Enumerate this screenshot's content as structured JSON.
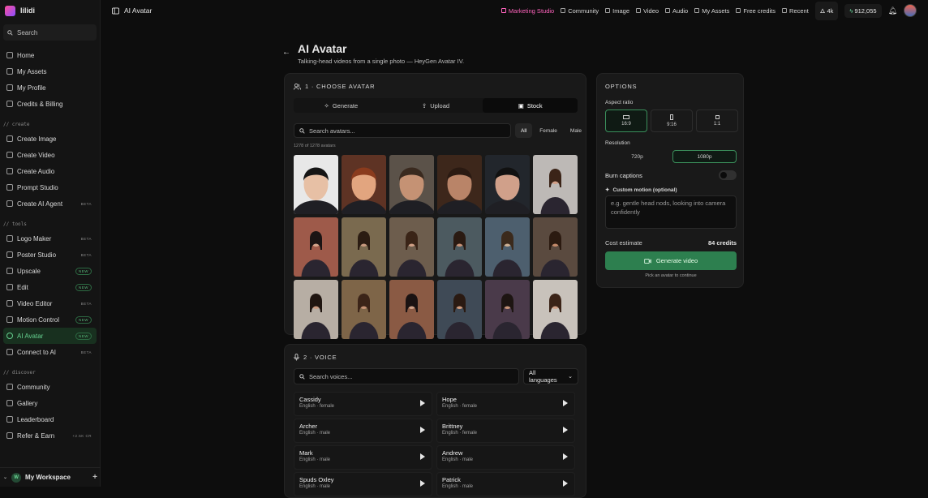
{
  "app": {
    "name": "lilidi",
    "page_title": "AI Avatar",
    "search_label": "Search",
    "workspace_name": "My Workspace",
    "workspace_initial": "W"
  },
  "sidebar": {
    "main": [
      {
        "label": "Home",
        "tag": ""
      },
      {
        "label": "My Assets",
        "tag": ""
      },
      {
        "label": "My Profile",
        "tag": ""
      },
      {
        "label": "Credits & Billing",
        "tag": ""
      }
    ],
    "create_title": "// create",
    "create": [
      {
        "label": "Create Image",
        "tag": ""
      },
      {
        "label": "Create Video",
        "tag": ""
      },
      {
        "label": "Create Audio",
        "tag": ""
      },
      {
        "label": "Prompt Studio",
        "tag": ""
      },
      {
        "label": "Create AI Agent",
        "tag": "BETA"
      }
    ],
    "tools_title": "// tools",
    "tools": [
      {
        "label": "Logo Maker",
        "tag": "BETA"
      },
      {
        "label": "Poster Studio",
        "tag": "BETA"
      },
      {
        "label": "Upscale",
        "tag": "NEW"
      },
      {
        "label": "Edit",
        "tag": "NEW"
      },
      {
        "label": "Video Editor",
        "tag": "BETA"
      },
      {
        "label": "Motion Control",
        "tag": "NEW"
      },
      {
        "label": "AI Avatar",
        "tag": "NEW",
        "active": true
      },
      {
        "label": "Connect to AI",
        "tag": "BETA"
      }
    ],
    "discover_title": "// discover",
    "discover": [
      {
        "label": "Community",
        "tag": ""
      },
      {
        "label": "Gallery",
        "tag": ""
      },
      {
        "label": "Leaderboard",
        "tag": ""
      },
      {
        "label": "Refer & Earn",
        "tag": "+2.5K CR"
      }
    ]
  },
  "topbar": {
    "links": [
      "Marketing Studio",
      "Community",
      "Image",
      "Video",
      "Audio",
      "My Assets",
      "Free credits",
      "Recent"
    ],
    "flame_count": "4k",
    "credits": "912,055"
  },
  "header": {
    "title": "AI Avatar",
    "subtitle": "Talking-head videos from a single photo — HeyGen Avatar IV."
  },
  "choose": {
    "title": "1 · CHOOSE AVATAR",
    "tabs": [
      "Generate",
      "Upload",
      "Stock"
    ],
    "search_placeholder": "Search avatars...",
    "filters": [
      "All",
      "Female",
      "Male"
    ],
    "count": "1278 of 1278 avatars",
    "avatars": [
      {
        "bg": "#e8e8e8",
        "skin": "#e7c0a5",
        "hair": "#151515"
      },
      {
        "bg": "#5e3324",
        "skin": "#e2a57f",
        "hair": "#8a3b1d"
      },
      {
        "bg": "#5b5249",
        "skin": "#c59274",
        "hair": "#3a2a1f"
      },
      {
        "bg": "#3d271b",
        "skin": "#b98468",
        "hair": "#2a1a12"
      },
      {
        "bg": "#22262c",
        "skin": "#d0a08a",
        "hair": "#111"
      },
      {
        "bg": "#bdb9b6",
        "skin": "#d3a088",
        "hair": "#3b2418"
      },
      {
        "bg": "#9e5a4a",
        "skin": "#d4a58c",
        "hair": "#1a1414"
      },
      {
        "bg": "#7a6a4f",
        "skin": "#c99a7e",
        "hair": "#2b1c12"
      },
      {
        "bg": "#6d5d4d",
        "skin": "#d1a086",
        "hair": "#3a2417"
      },
      {
        "bg": "#4c5a60",
        "skin": "#c99377",
        "hair": "#2a1a12"
      },
      {
        "bg": "#4d5f6e",
        "skin": "#ceb094",
        "hair": "#3b2a1c"
      },
      {
        "bg": "#5a4a3f",
        "skin": "#c58a6a",
        "hair": "#2b1a10"
      },
      {
        "bg": "#b7aea4",
        "skin": "#c99a80",
        "hair": "#1f1510"
      },
      {
        "bg": "#7e6548",
        "skin": "#c69274",
        "hair": "#3b2418"
      },
      {
        "bg": "#8a5a44",
        "skin": "#d0a38a",
        "hair": "#1a1212"
      },
      {
        "bg": "#3f4a56",
        "skin": "#cf9b7d",
        "hair": "#2a1a12"
      },
      {
        "bg": "#4a3a4a",
        "skin": "#c79477",
        "hair": "#1d1512"
      },
      {
        "bg": "#c8c2bb",
        "skin": "#d2a38a",
        "hair": "#3b2418"
      }
    ]
  },
  "voice": {
    "title": "2 · VOICE",
    "search_placeholder": "Search voices...",
    "language": "All languages",
    "items": [
      {
        "name": "Cassidy",
        "meta": "English · female"
      },
      {
        "name": "Hope",
        "meta": "English · female"
      },
      {
        "name": "Archer",
        "meta": "English · male"
      },
      {
        "name": "Brittney",
        "meta": "English · female"
      },
      {
        "name": "Mark",
        "meta": "English · male"
      },
      {
        "name": "Andrew",
        "meta": "English · male"
      },
      {
        "name": "Spuds Oxley",
        "meta": "English · male"
      },
      {
        "name": "Patrick",
        "meta": "English · male"
      }
    ]
  },
  "options": {
    "title": "OPTIONS",
    "aspect_label": "Aspect ratio",
    "aspects": [
      "16:9",
      "9:16",
      "1:1"
    ],
    "resolution_label": "Resolution",
    "resolutions": [
      "720p",
      "1080p"
    ],
    "captions_label": "Burn captions",
    "motion_label": "Custom motion (optional)",
    "motion_placeholder": "e.g. gentle head nods, looking into camera confidently",
    "cost_label": "Cost estimate",
    "cost_value": "84 credits",
    "generate_label": "Generate video",
    "hint": "Pick an avatar to continue"
  }
}
